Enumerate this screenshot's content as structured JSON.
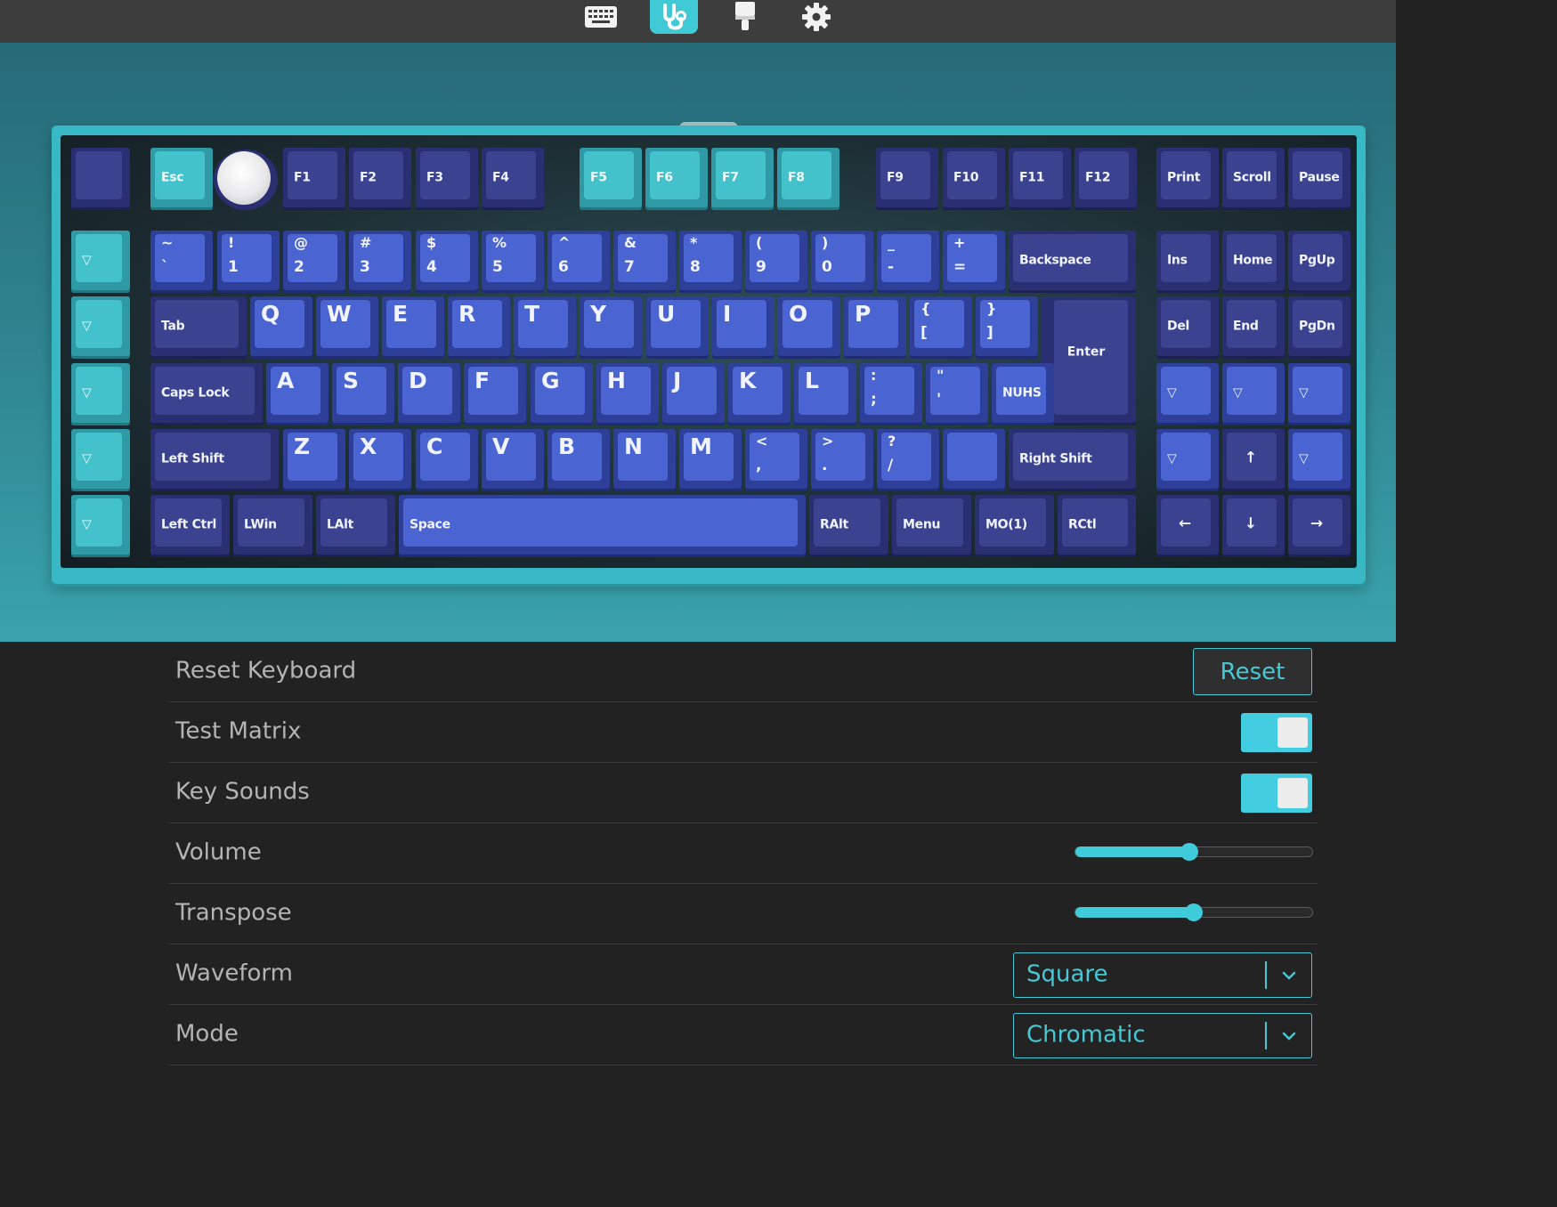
{
  "nav": {
    "items": [
      {
        "name": "keyboard-icon"
      },
      {
        "name": "stethoscope-icon",
        "active": true
      },
      {
        "name": "paintbrush-icon"
      },
      {
        "name": "gear-icon"
      }
    ]
  },
  "keyboard": {
    "rows": {
      "fn": {
        "macro_left": "",
        "esc": "Esc",
        "f1": "F1",
        "f2": "F2",
        "f3": "F3",
        "f4": "F4",
        "f5": "F5",
        "f6": "F6",
        "f7": "F7",
        "f8": "F8",
        "f9": "F9",
        "f10": "F10",
        "f11": "F11",
        "f12": "F12",
        "print": "Print",
        "scroll": "Scroll",
        "pause": "Pause"
      },
      "macro_col": [
        "▽",
        "▽",
        "▽",
        "▽",
        "▽"
      ],
      "number": [
        {
          "top": "~",
          "bot": "`"
        },
        {
          "top": "!",
          "bot": "1"
        },
        {
          "top": "@",
          "bot": "2"
        },
        {
          "top": "#",
          "bot": "3"
        },
        {
          "top": "$",
          "bot": "4"
        },
        {
          "top": "%",
          "bot": "5"
        },
        {
          "top": "^",
          "bot": "6"
        },
        {
          "top": "&",
          "bot": "7"
        },
        {
          "top": "*",
          "bot": "8"
        },
        {
          "top": "(",
          "bot": "9"
        },
        {
          "top": ")",
          "bot": "0"
        },
        {
          "top": "_",
          "bot": "-"
        },
        {
          "top": "+",
          "bot": "="
        }
      ],
      "backspace": "Backspace",
      "ins": "Ins",
      "home": "Home",
      "pgup": "PgUp",
      "tab": "Tab",
      "qwerty": [
        "Q",
        "W",
        "E",
        "R",
        "T",
        "Y",
        "U",
        "I",
        "O",
        "P"
      ],
      "bracket_l": {
        "top": "{",
        "bot": "["
      },
      "bracket_r": {
        "top": "}",
        "bot": "]"
      },
      "enter": "Enter",
      "del": "Del",
      "end": "End",
      "pgdn": "PgDn",
      "caps": "Caps Lock",
      "asdf": [
        "A",
        "S",
        "D",
        "F",
        "G",
        "H",
        "J",
        "K",
        "L"
      ],
      "semicolon": {
        "top": ":",
        "bot": ";"
      },
      "quote": {
        "top": "\"",
        "bot": "'"
      },
      "nuhs": "NUHS",
      "nav_mid": [
        "▽",
        "▽",
        "▽"
      ],
      "lshift": "Left Shift",
      "zxcv": [
        "Z",
        "X",
        "C",
        "V",
        "B",
        "N",
        "M"
      ],
      "comma": {
        "top": "<",
        "bot": ","
      },
      "period": {
        "top": ">",
        "bot": "."
      },
      "slash": {
        "top": "?",
        "bot": "/"
      },
      "blank": "",
      "rshift": "Right Shift",
      "nav_low_left": "▽",
      "up": "↑",
      "nav_low_right": "▽",
      "lctrl": "Left Ctrl",
      "lwin": "LWin",
      "lalt": "LAlt",
      "space": "Space",
      "ralt": "RAlt",
      "menu": "Menu",
      "mo1": "MO(1)",
      "rctl": "RCtl",
      "left": "←",
      "down": "↓",
      "right": "→"
    }
  },
  "settings": {
    "reset_keyboard": {
      "label": "Reset Keyboard",
      "button": "Reset"
    },
    "test_matrix": {
      "label": "Test Matrix",
      "on": true
    },
    "key_sounds": {
      "label": "Key Sounds",
      "on": true
    },
    "volume": {
      "label": "Volume",
      "value_fraction": 0.48
    },
    "transpose": {
      "label": "Transpose",
      "value_fraction": 0.5
    },
    "waveform": {
      "label": "Waveform",
      "value": "Square"
    },
    "mode": {
      "label": "Mode",
      "value": "Chromatic"
    }
  },
  "colors": {
    "accent": "#46c9d5",
    "key_blue": "#4a64d2",
    "key_dark": "#3b4391",
    "key_teal": "#44c2cb"
  }
}
